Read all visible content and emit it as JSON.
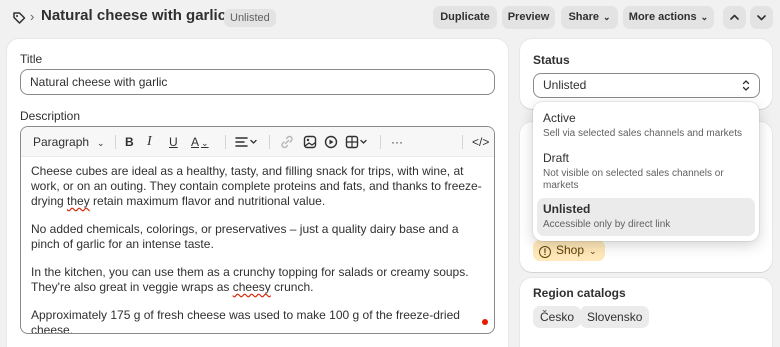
{
  "header": {
    "tag_icon": "tag-icon",
    "separator": "›",
    "title": "Natural cheese with garlic",
    "badge": "Unlisted",
    "buttons": {
      "duplicate": "Duplicate",
      "preview": "Preview",
      "share": "Share",
      "more_actions": "More actions"
    },
    "nav_icons": [
      "chevron-up-icon",
      "chevron-down-icon"
    ]
  },
  "main": {
    "title_label": "Title",
    "title_value": "Natural cheese with garlic",
    "description_label": "Description",
    "toolbar": {
      "paragraph": "Paragraph",
      "bold": "B",
      "italic": "I",
      "underline": "U",
      "text_color": "A",
      "align_icon": "align-left-icon",
      "link_icon": "link-icon",
      "image_icon": "image-icon",
      "video_icon": "video-icon",
      "insert_icon": "insert-icon",
      "more": "···",
      "code": "</>"
    },
    "description": {
      "p1_a": "Cheese cubes are ideal as a healthy, tasty, and filling snack for trips, with wine, at work, or on an outing. They contain complete proteins and fats, and thanks to freeze-drying ",
      "p1_spell": "they",
      "p1_b": " retain maximum flavor and nutritional value.",
      "p2": "No added chemicals, colorings, or preservatives – just a quality dairy base and a pinch of garlic for an intense taste.",
      "p3_a": "In the kitchen, you can use them as a crunchy topping for salads or creamy soups. They're also great in veggie wraps as ",
      "p3_spell": "cheesy",
      "p3_b": " crunch.",
      "p4": "Approximately 175 g of fresh cheese was used to make 100 g of the freeze-dried cheese."
    }
  },
  "status": {
    "label": "Status",
    "selected": "Unlisted",
    "options": [
      {
        "label": "Active",
        "description": "Sell via selected sales channels and markets"
      },
      {
        "label": "Draft",
        "description": "Not visible on selected sales channels or markets"
      },
      {
        "label": "Unlisted",
        "description": "Accessible only by direct link"
      }
    ]
  },
  "publishing": {
    "shop_label": "Shop"
  },
  "region": {
    "label": "Region catalogs",
    "chips": [
      "Česko",
      "Slovensko"
    ]
  },
  "colors": {
    "background": "#f1f1f1",
    "card": "#ffffff",
    "warning_bg": "#ffe8ba",
    "spellcheck": "#d72c0d"
  }
}
